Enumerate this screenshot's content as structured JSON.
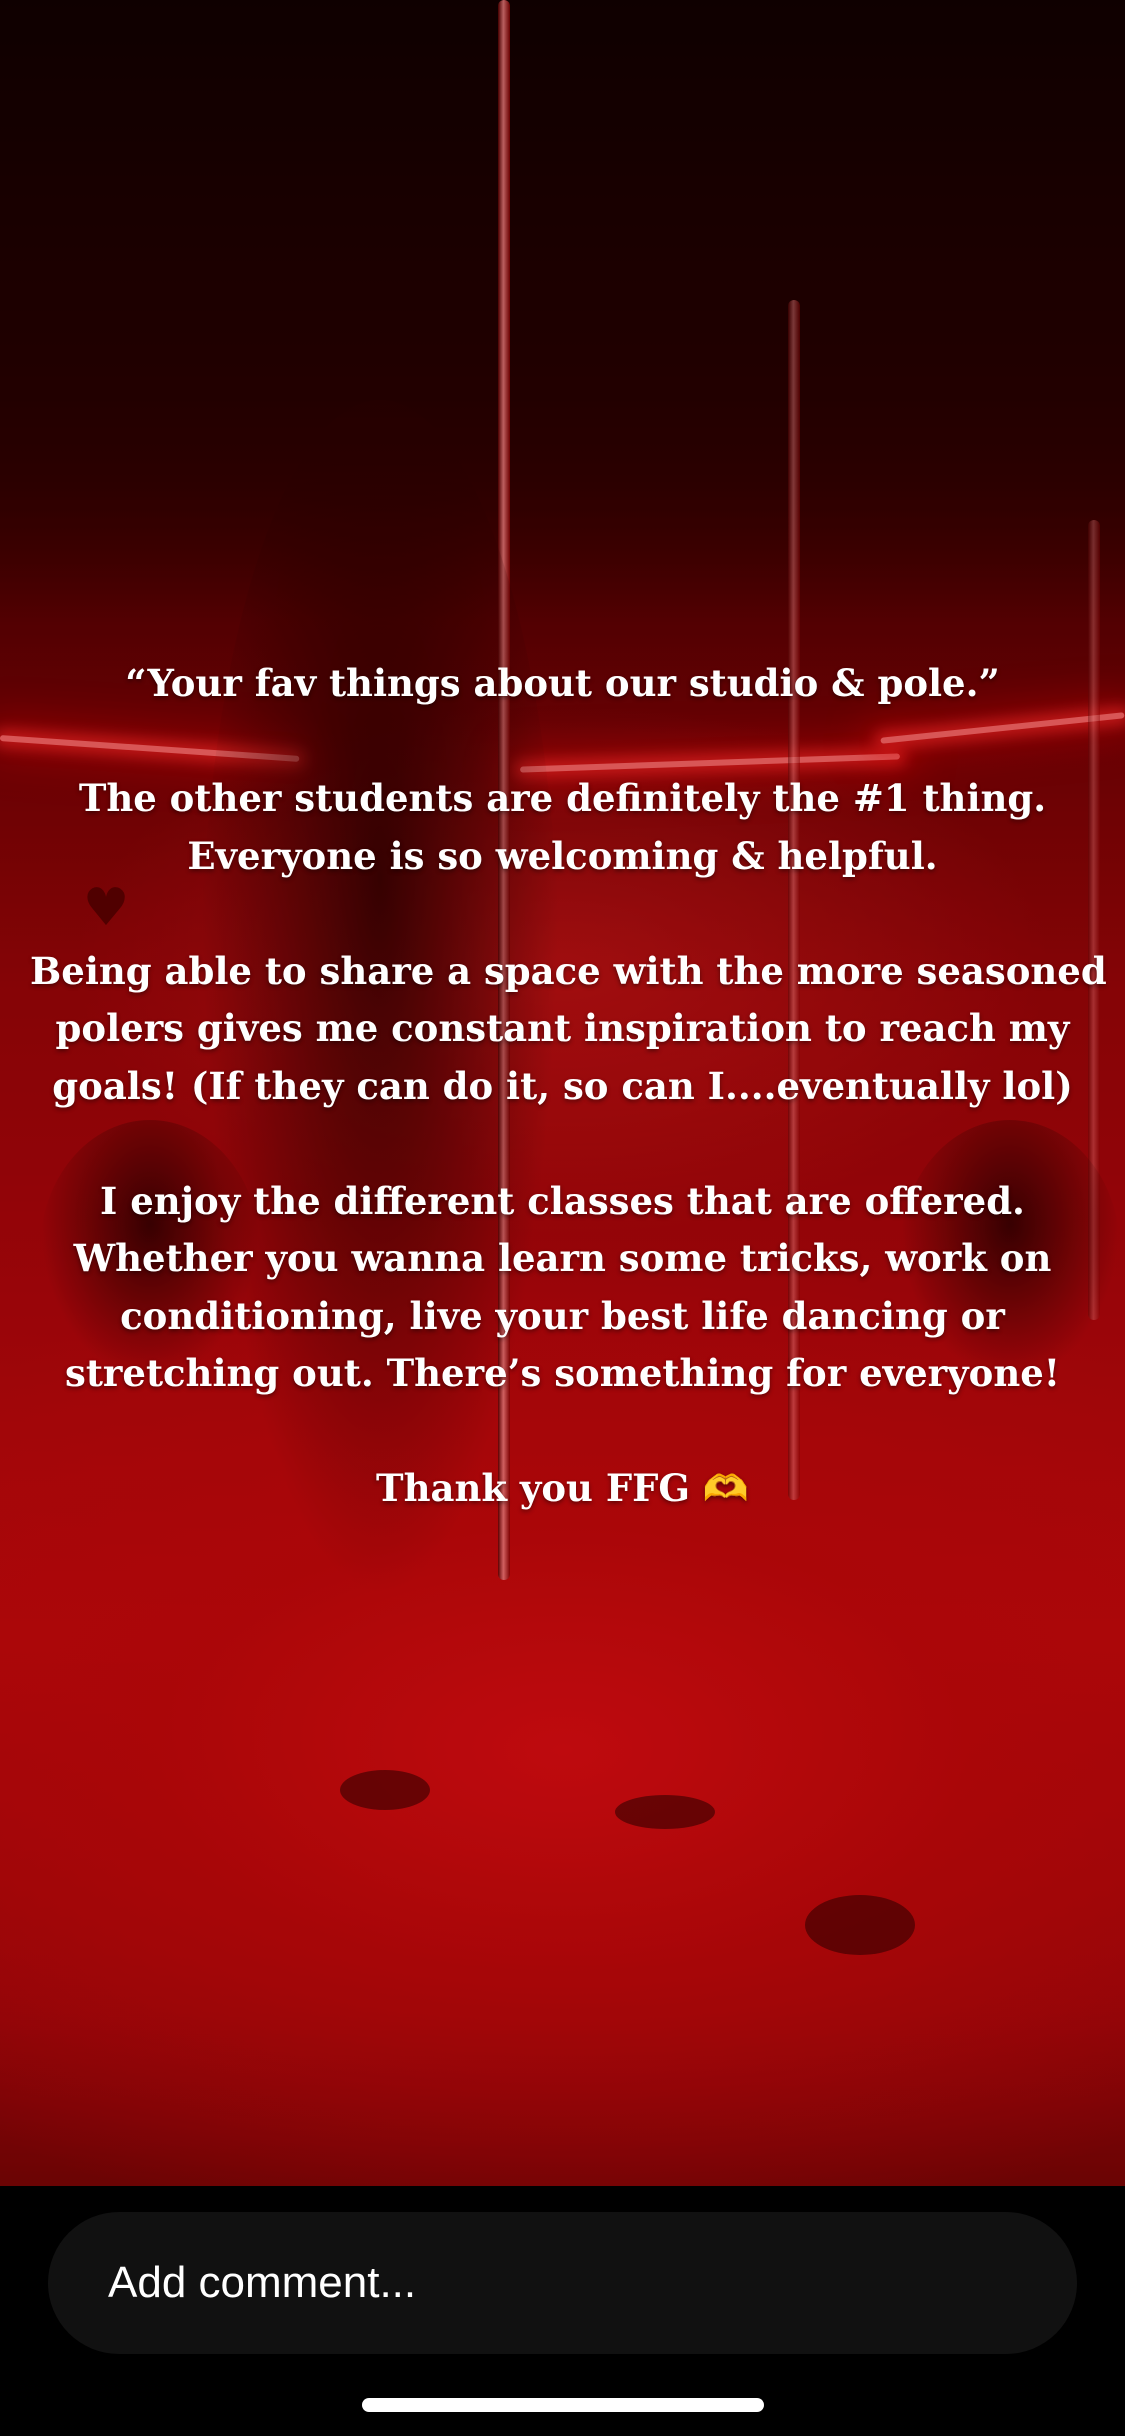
{
  "story": {
    "caption_lines": [
      "“Your fav things about our studio & pole.”",
      "",
      "The other students  are definitely the #1  thing.",
      "Everyone is so welcoming & helpful.",
      "",
      "Being able to share a space with the more seasoned",
      "polers gives me constant inspiration to reach my",
      "goals! (If they can do it, so can I....eventually lol)",
      "",
      "I enjoy the different classes that are offered.",
      "Whether you wanna learn some tricks, work on",
      "conditioning, live your best life dancing or",
      "stretching out. There’s something for everyone!",
      "",
      "Thank you FFG"
    ],
    "closing_emoji": "🫶",
    "colors": {
      "background_red": "#c90a0e",
      "text": "#ffffff"
    }
  },
  "comment": {
    "placeholder": "Add comment..."
  },
  "icons": {
    "closing": "heart-hands-icon",
    "wall_heart": "heart-decoration-icon"
  }
}
